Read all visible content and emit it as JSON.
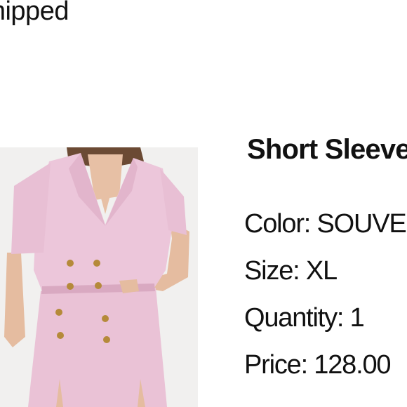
{
  "order": {
    "status_text": "Shipped"
  },
  "item": {
    "name": "Short Sleeve",
    "color_label": "Color: SOUVENIR PINK",
    "size_label": "Size: XL",
    "quantity_label": "Quantity: 1",
    "price_label": "Price: 128.00"
  },
  "colors": {
    "background": "#ffffff",
    "text": "#111111",
    "garment": "#ecc6da",
    "buttons": "#b58a3a"
  }
}
